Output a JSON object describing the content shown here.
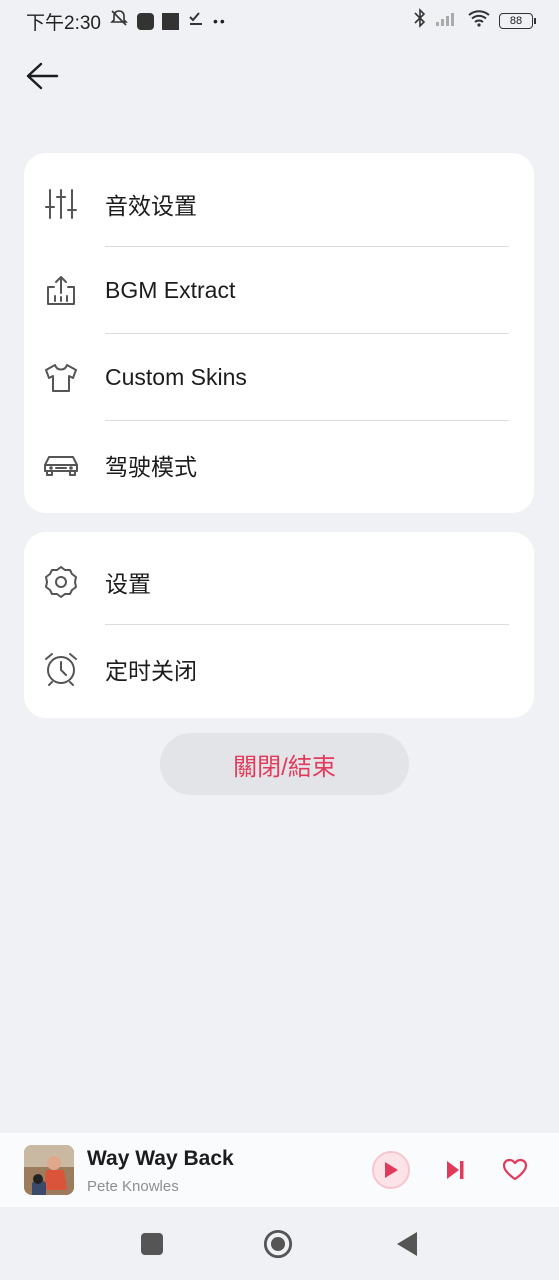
{
  "status_bar": {
    "time": "下午2:30",
    "battery": "88"
  },
  "menu_group_1": {
    "items": [
      {
        "label": "音效设置",
        "icon": "equalizer-icon"
      },
      {
        "label": "BGM Extract",
        "icon": "upload-extract-icon"
      },
      {
        "label": "Custom Skins",
        "icon": "tshirt-icon"
      },
      {
        "label": "驾驶模式",
        "icon": "car-icon"
      }
    ]
  },
  "menu_group_2": {
    "items": [
      {
        "label": "设置",
        "icon": "gear-icon"
      },
      {
        "label": "定时关闭",
        "icon": "alarm-clock-icon"
      }
    ]
  },
  "close_button": {
    "label": "關閉/結束"
  },
  "player": {
    "title": "Way Way Back",
    "artist": "Pete Knowles"
  },
  "colors": {
    "accent": "#e23a5a",
    "background": "#f0f1f5",
    "card": "#ffffff"
  }
}
